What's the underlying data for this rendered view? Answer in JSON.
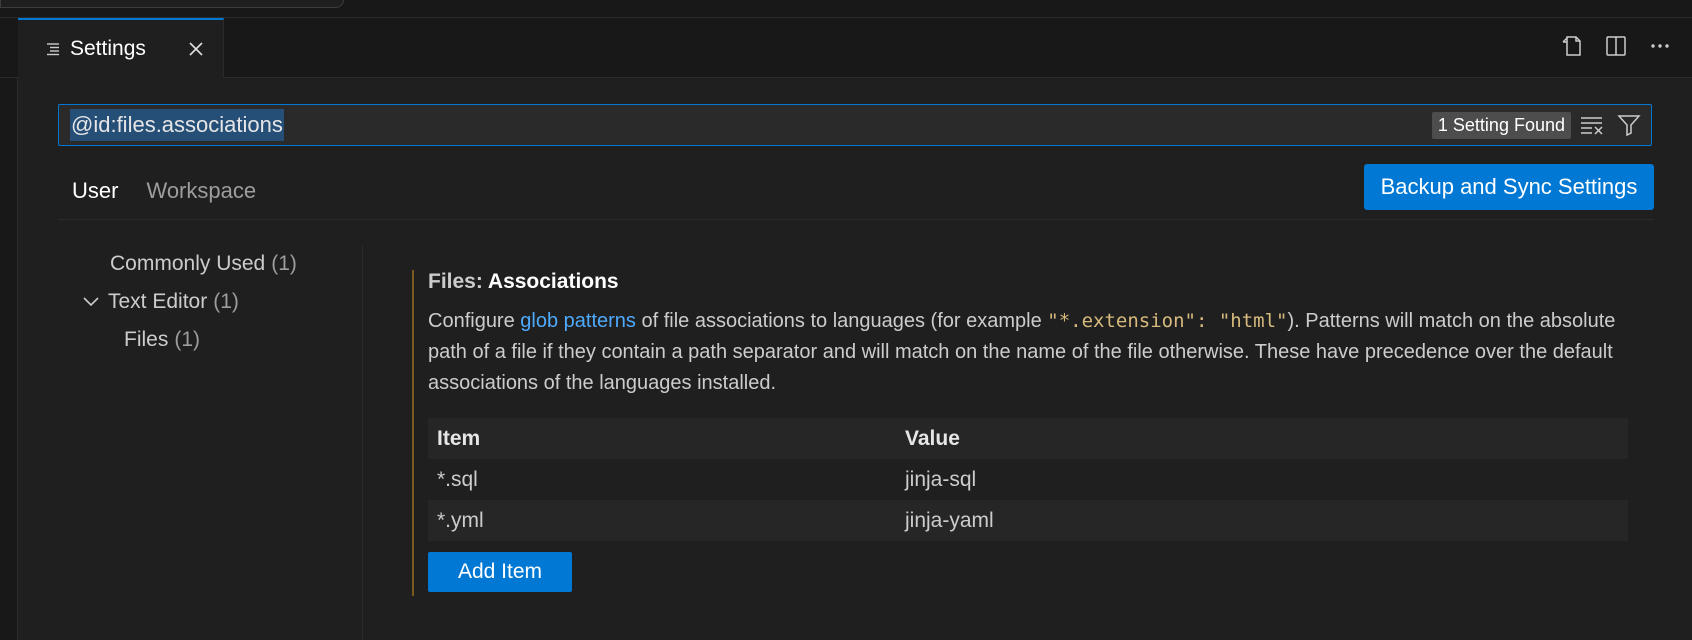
{
  "tab": {
    "label": "Settings",
    "icon": "settings-lines-icon",
    "close_icon": "close-icon"
  },
  "editor_actions": [
    "open-settings-json-icon",
    "split-editor-icon",
    "more-actions-icon"
  ],
  "search": {
    "query": "@id:files.associations",
    "result_count": "1 Setting Found",
    "clear_icon": "clear-filter-icon",
    "filter_icon": "filter-icon"
  },
  "scopes": {
    "user": "User",
    "workspace": "Workspace",
    "active": "User"
  },
  "sync_button": "Backup and Sync Settings",
  "toc": [
    {
      "label": "Commonly Used",
      "count": "(1)"
    },
    {
      "label": "Text Editor",
      "count": "(1)",
      "expanded": true
    },
    {
      "label": "Files",
      "count": "(1)"
    }
  ],
  "setting": {
    "category": "Files: ",
    "name": "Associations",
    "desc_1": "Configure ",
    "desc_link": "glob patterns",
    "desc_2": " of file associations to languages (for example ",
    "desc_code": "\"*.extension\": \"html\"",
    "desc_3": "). Patterns will match on the absolute path of a file if they contain a path separator and will match on the name of the file otherwise. These have precedence over the default associations of the languages installed.",
    "table_headers": {
      "item": "Item",
      "value": "Value"
    },
    "rows": [
      {
        "item": "*.sql",
        "value": "jinja-sql"
      },
      {
        "item": "*.yml",
        "value": "jinja-yaml"
      }
    ],
    "add_button": "Add Item"
  },
  "colors": {
    "accent": "#0078d4",
    "modified_bar": "#7a5a1f",
    "link": "#4daafc"
  }
}
